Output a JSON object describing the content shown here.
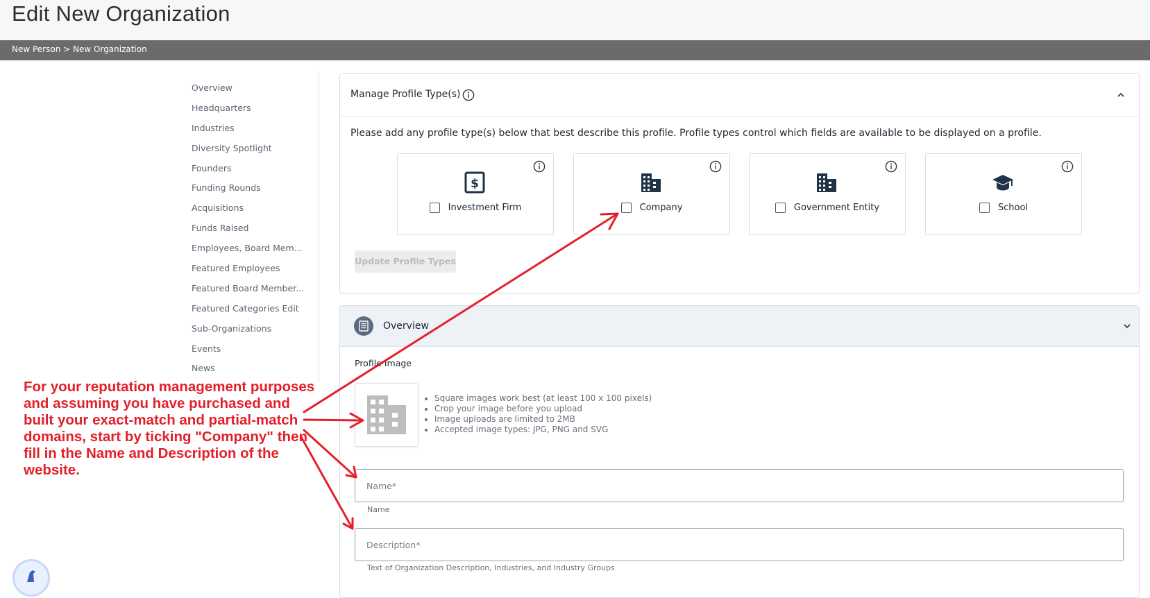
{
  "page": {
    "title": "Edit New Organization",
    "breadcrumb": "New Person > New Organization"
  },
  "sidebar": {
    "items": [
      {
        "label": "Overview"
      },
      {
        "label": "Headquarters"
      },
      {
        "label": "Industries"
      },
      {
        "label": "Diversity Spotlight"
      },
      {
        "label": "Founders"
      },
      {
        "label": "Funding Rounds"
      },
      {
        "label": "Acquisitions"
      },
      {
        "label": "Funds Raised"
      },
      {
        "label": "Employees, Board Mem..."
      },
      {
        "label": "Featured Employees"
      },
      {
        "label": "Featured Board Member..."
      },
      {
        "label": "Featured Categories Edit"
      },
      {
        "label": "Sub-Organizations"
      },
      {
        "label": "Events"
      },
      {
        "label": "News"
      }
    ]
  },
  "profile_types": {
    "title": "Manage Profile Type(s)",
    "description": "Please add any profile type(s) below that best describe this profile. Profile types control which fields are available to be displayed on a profile.",
    "types": [
      {
        "label": "Investment Firm",
        "icon": "dollar-icon",
        "checked": false
      },
      {
        "label": "Company",
        "icon": "building-icon",
        "checked": false
      },
      {
        "label": "Government Entity",
        "icon": "building-icon",
        "checked": false
      },
      {
        "label": "School",
        "icon": "graduation-cap-icon",
        "checked": false
      }
    ],
    "update_button": "Update Profile Types"
  },
  "overview": {
    "title": "Overview",
    "profile_image_label": "Profile Image",
    "tips": [
      "Square images work best (at least 100 x 100 pixels)",
      "Crop your image before you upload",
      "Image uploads are limited to 2MB",
      "Accepted image types: JPG, PNG and SVG"
    ],
    "name_placeholder": "Name*",
    "name_helper": "Name",
    "description_placeholder": "Description*",
    "description_helper": "Text of Organization Description, Industries, and Industry Groups"
  },
  "annotation": {
    "text": "For your reputation management purposes and assuming you have purchased and built your exact-match and partial-match domains, start by ticking \"Company\" then fill in the Name and Description of the website.",
    "color": "#e3202a"
  },
  "colors": {
    "header_bg": "#f6f7f9",
    "breadcrumb_bg": "#6b6b6b",
    "icon_dark": "#1e3346",
    "overview_icon_bg": "#5b6b82"
  }
}
